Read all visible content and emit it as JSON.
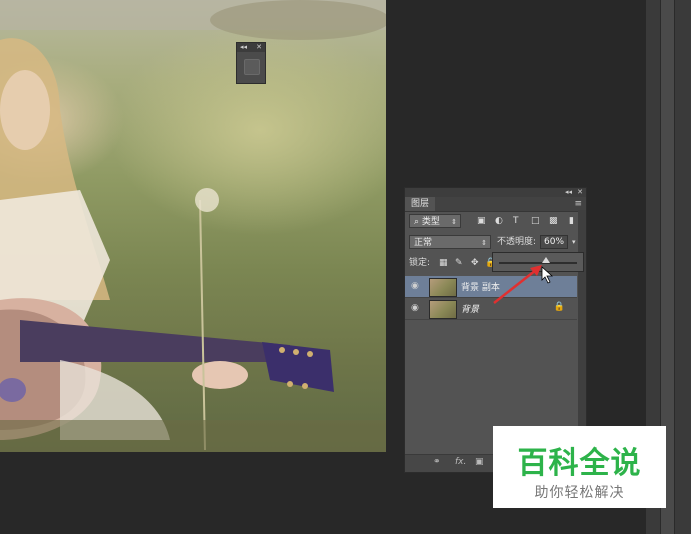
{
  "mini_panel": {
    "collapse": "◂◂",
    "close": "✕"
  },
  "layers_panel": {
    "collapse": "◂◂",
    "close": "✕",
    "tab_label": "图层",
    "menu_icon": "≡",
    "filter": {
      "search_icon": "⌕",
      "value": "类型",
      "icons": [
        "image-filter-icon",
        "adjustment-filter-icon",
        "type-filter-icon",
        "shape-filter-icon",
        "smart-object-filter-icon"
      ]
    },
    "blend_mode": "正常",
    "opacity": {
      "label": "不透明度:",
      "value": "60%",
      "level": 0.6
    },
    "lock": {
      "label": "锁定:"
    },
    "layers": [
      {
        "name": "背景 副本",
        "selected": true,
        "visible": true
      },
      {
        "name": "背景",
        "selected": false,
        "visible": true,
        "locked": true
      }
    ],
    "bottom_icons": [
      "link-icon",
      "fx-icon",
      "mask-icon"
    ],
    "fx_label": "fx."
  },
  "watermark": {
    "title": "百科全说",
    "subtitle": "助你轻松解决"
  },
  "colors": {
    "selected_row": "#6e7f98",
    "panel_bg": "#535353",
    "arrow": "#e03030",
    "watermark_green": "#2db34a"
  }
}
